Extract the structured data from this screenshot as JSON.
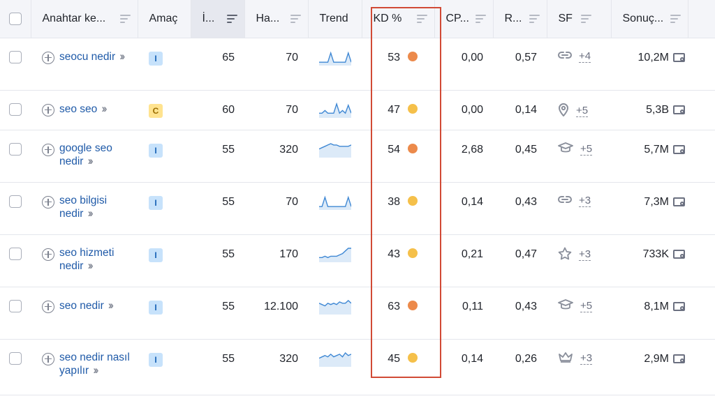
{
  "colors": {
    "header_bg": "#f4f5f9",
    "link": "#1f5aa8",
    "kd_orange": "#ec8a4b",
    "kd_yellow": "#f5c04a",
    "highlight_border": "#d14a35",
    "intent_i_bg": "#c7e2fb",
    "intent_c_bg": "#ffe38f"
  },
  "columns": {
    "keyword": "Anahtar ke...",
    "intent": "Amaç",
    "position": "İ...",
    "volume": "Ha...",
    "trend": "Trend",
    "kd": "KD %",
    "cpc": "CP...",
    "com": "R...",
    "sf": "SF",
    "results": "Sonuç..."
  },
  "rows": [
    {
      "keyword": "seocu nedir",
      "intent": "I",
      "position": "65",
      "volume": "70",
      "trend": [
        2,
        2,
        2,
        2,
        9,
        2,
        2,
        2,
        2,
        2,
        9,
        2
      ],
      "kd": "53",
      "kd_level": "orange",
      "cpc": "0,00",
      "com": "0,57",
      "sf_icon": "link-icon",
      "sf_count": "+4",
      "results": "10,2M"
    },
    {
      "keyword": "seo seo",
      "intent": "C",
      "position": "60",
      "volume": "70",
      "trend": [
        3,
        3,
        5,
        3,
        3,
        3,
        10,
        3,
        5,
        3,
        9,
        3
      ],
      "kd": "47",
      "kd_level": "yellow",
      "cpc": "0,00",
      "com": "0,14",
      "sf_icon": "pin-icon",
      "sf_count": "+5",
      "results": "5,3B"
    },
    {
      "keyword": "google seo nedir",
      "intent": "I",
      "position": "55",
      "volume": "320",
      "trend": [
        6,
        7,
        8,
        9,
        10,
        9,
        9,
        8,
        8,
        8,
        8,
        9
      ],
      "kd": "54",
      "kd_level": "orange",
      "cpc": "2,68",
      "com": "0,45",
      "sf_icon": "cap-icon",
      "sf_count": "+5",
      "results": "5,7M"
    },
    {
      "keyword": "seo bilgisi nedir",
      "intent": "I",
      "position": "55",
      "volume": "70",
      "trend": [
        2,
        2,
        9,
        2,
        2,
        2,
        2,
        2,
        2,
        2,
        9,
        2
      ],
      "kd": "38",
      "kd_level": "yellow",
      "cpc": "0,14",
      "com": "0,43",
      "sf_icon": "link-icon",
      "sf_count": "+3",
      "results": "7,3M"
    },
    {
      "keyword": "seo hizmeti nedir",
      "intent": "I",
      "position": "55",
      "volume": "170",
      "trend": [
        3,
        3,
        4,
        3,
        4,
        4,
        4,
        5,
        6,
        8,
        10,
        10
      ],
      "kd": "43",
      "kd_level": "yellow",
      "cpc": "0,21",
      "com": "0,47",
      "sf_icon": "star-icon",
      "sf_count": "+3",
      "results": "733K"
    },
    {
      "keyword": "seo nedir",
      "intent": "I",
      "position": "55",
      "volume": "12.100",
      "trend": [
        8,
        7,
        6,
        8,
        7,
        8,
        7,
        9,
        8,
        8,
        10,
        8
      ],
      "kd": "63",
      "kd_level": "orange",
      "cpc": "0,11",
      "com": "0,43",
      "sf_icon": "cap-icon",
      "sf_count": "+5",
      "results": "8,1M"
    },
    {
      "keyword": "seo nedir nasıl yapılır",
      "intent": "I",
      "position": "55",
      "volume": "320",
      "trend": [
        6,
        7,
        8,
        7,
        9,
        7,
        8,
        9,
        7,
        10,
        8,
        9
      ],
      "kd": "45",
      "kd_level": "yellow",
      "cpc": "0,14",
      "com": "0,26",
      "sf_icon": "crown-icon",
      "sf_count": "+3",
      "results": "2,9M"
    }
  ]
}
